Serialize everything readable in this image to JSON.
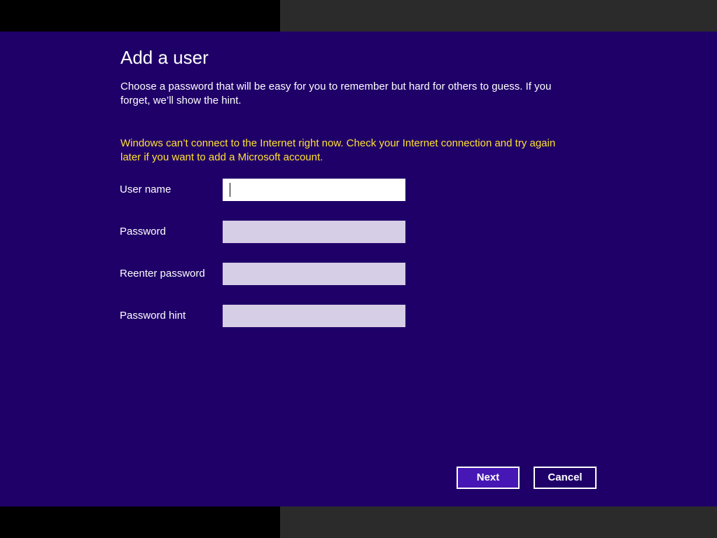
{
  "dialog": {
    "title": "Add a user",
    "description": "Choose a password that will be easy for you to remember but hard for others to guess. If you forget, we’ll show the hint.",
    "warning": "Windows can’t connect to the Internet right now. Check your Internet connection and try again later if you want to add a Microsoft account."
  },
  "form": {
    "username": {
      "label": "User name",
      "value": ""
    },
    "password": {
      "label": "Password",
      "value": ""
    },
    "reenter_password": {
      "label": "Reenter password",
      "value": ""
    },
    "password_hint": {
      "label": "Password hint",
      "value": ""
    }
  },
  "buttons": {
    "next": "Next",
    "cancel": "Cancel"
  },
  "colors": {
    "dialog_background": "#1f0068",
    "warning_text": "#ffe033",
    "next_button_background": "#4617b4",
    "inactive_field": "#d6cde6"
  }
}
